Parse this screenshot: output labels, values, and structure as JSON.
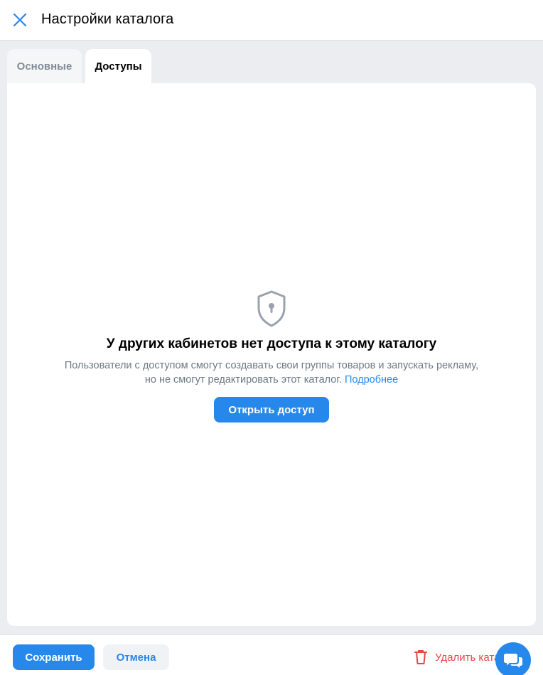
{
  "header": {
    "title": "Настройки каталога"
  },
  "tabs": [
    {
      "label": "Основные",
      "active": false
    },
    {
      "label": "Доступы",
      "active": true
    }
  ],
  "empty_state": {
    "title": "У других кабинетов нет доступа к этому каталогу",
    "description_line1": "Пользователи с доступом смогут создавать свои группы товаров и запускать рекламу,",
    "description_line2": "но не смогут редактировать этот каталог.",
    "link_text": "Подробнее",
    "button_label": "Открыть доступ"
  },
  "footer": {
    "save_label": "Сохранить",
    "cancel_label": "Отмена",
    "delete_label": "Удалить каталог"
  },
  "colors": {
    "accent": "#2688eb",
    "danger": "#e64646",
    "muted_text": "#6d7885",
    "background": "#ebedf0"
  },
  "icons": {
    "close": "close-icon",
    "shield": "shield-keyhole-icon",
    "trash": "trash-icon",
    "chat": "chat-bubbles-icon"
  }
}
